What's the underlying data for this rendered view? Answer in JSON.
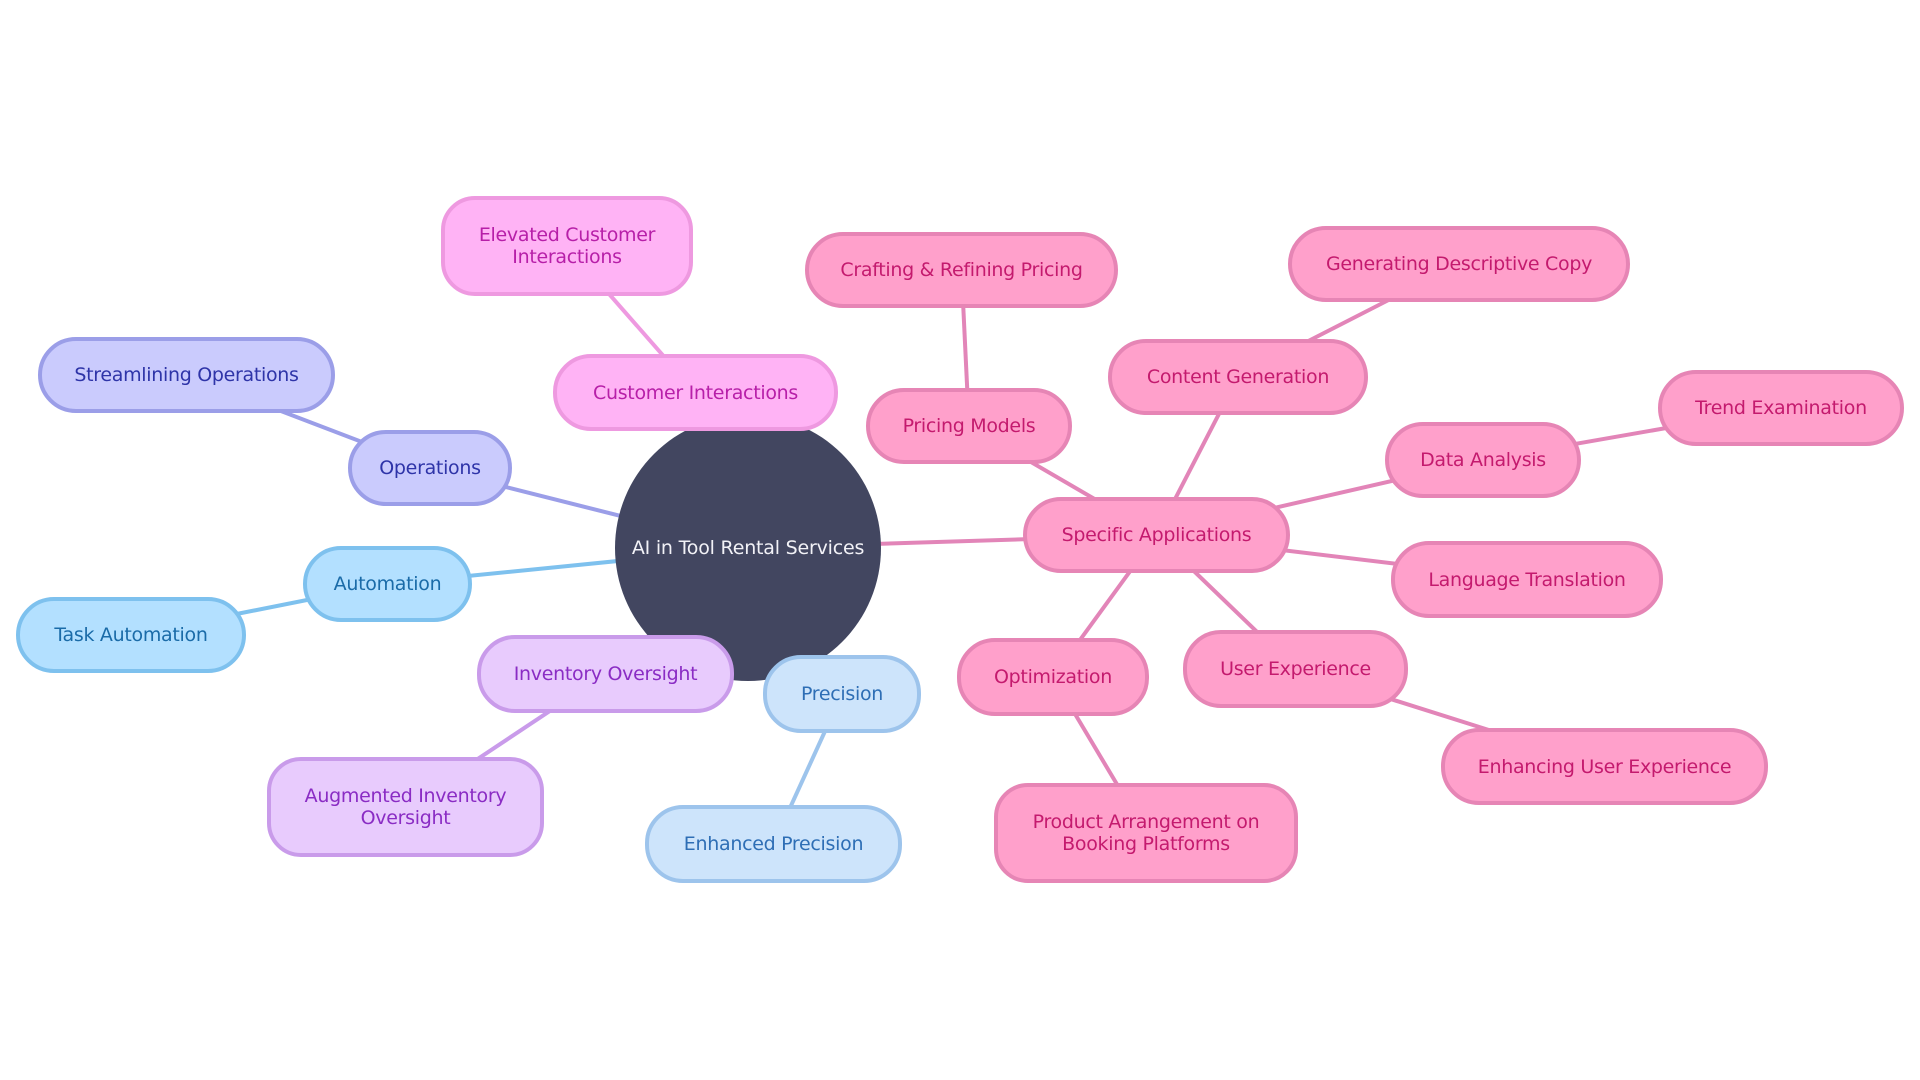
{
  "diagram": {
    "type": "mindmap",
    "root": {
      "id": "root",
      "label": "AI in Tool Rental Services"
    },
    "branches": {
      "ops": {
        "fill": "#CACBFD",
        "border": "#9B9EE8",
        "text": "#2E34A8",
        "edge": "#9B9EE8"
      },
      "auto": {
        "fill": "#B3E0FF",
        "border": "#7EC1EE",
        "text": "#1A6BA8",
        "edge": "#7EC1EE"
      },
      "inv": {
        "fill": "#E8CBFD",
        "border": "#C99BEA",
        "text": "#8A2CC4",
        "edge": "#C99BEA"
      },
      "prec": {
        "fill": "#CDE4FB",
        "border": "#9DC4EC",
        "text": "#2E6EB5",
        "edge": "#9DC4EC"
      },
      "cust": {
        "fill": "#FFB3F5",
        "border": "#EE99E0",
        "text": "#B71FA8",
        "edge": "#EE99E0"
      },
      "spec": {
        "fill": "#FFA0CB",
        "border": "#E685B5",
        "text": "#C41A6E",
        "edge": "#E285B8"
      }
    },
    "nodes": [
      {
        "id": "operations",
        "label": "Operations",
        "parent": "root",
        "branch": "ops"
      },
      {
        "id": "streamlining-operations",
        "label": "Streamlining Operations",
        "parent": "operations",
        "branch": "ops"
      },
      {
        "id": "automation",
        "label": "Automation",
        "parent": "root",
        "branch": "auto"
      },
      {
        "id": "task-automation",
        "label": "Task Automation",
        "parent": "automation",
        "branch": "auto"
      },
      {
        "id": "inventory-oversight",
        "label": "Inventory Oversight",
        "parent": "root",
        "branch": "inv"
      },
      {
        "id": "augmented-inventory-oversight",
        "label": "Augmented Inventory\nOversight",
        "parent": "inventory-oversight",
        "branch": "inv"
      },
      {
        "id": "precision",
        "label": "Precision",
        "parent": "root",
        "branch": "prec"
      },
      {
        "id": "enhanced-precision",
        "label": "Enhanced Precision",
        "parent": "precision",
        "branch": "prec"
      },
      {
        "id": "customer-interactions",
        "label": "Customer Interactions",
        "parent": "root",
        "branch": "cust"
      },
      {
        "id": "elevated-customer-interactions",
        "label": "Elevated Customer\nInteractions",
        "parent": "customer-interactions",
        "branch": "cust"
      },
      {
        "id": "specific-applications",
        "label": "Specific Applications",
        "parent": "root",
        "branch": "spec"
      },
      {
        "id": "pricing-models",
        "label": "Pricing Models",
        "parent": "specific-applications",
        "branch": "spec"
      },
      {
        "id": "crafting-refining-pricing",
        "label": "Crafting & Refining Pricing",
        "parent": "pricing-models",
        "branch": "spec"
      },
      {
        "id": "content-generation",
        "label": "Content Generation",
        "parent": "specific-applications",
        "branch": "spec"
      },
      {
        "id": "generating-descriptive-copy",
        "label": "Generating Descriptive Copy",
        "parent": "content-generation",
        "branch": "spec"
      },
      {
        "id": "data-analysis",
        "label": "Data Analysis",
        "parent": "specific-applications",
        "branch": "spec"
      },
      {
        "id": "trend-examination",
        "label": "Trend Examination",
        "parent": "data-analysis",
        "branch": "spec"
      },
      {
        "id": "language-translation",
        "label": "Language Translation",
        "parent": "specific-applications",
        "branch": "spec"
      },
      {
        "id": "user-experience",
        "label": "User Experience",
        "parent": "specific-applications",
        "branch": "spec"
      },
      {
        "id": "enhancing-user-experience",
        "label": "Enhancing User Experience",
        "parent": "user-experience",
        "branch": "spec"
      },
      {
        "id": "optimization",
        "label": "Optimization",
        "parent": "specific-applications",
        "branch": "spec"
      },
      {
        "id": "product-arrangement",
        "label": "Product Arrangement on\nBooking Platforms",
        "parent": "optimization",
        "branch": "spec"
      }
    ]
  }
}
